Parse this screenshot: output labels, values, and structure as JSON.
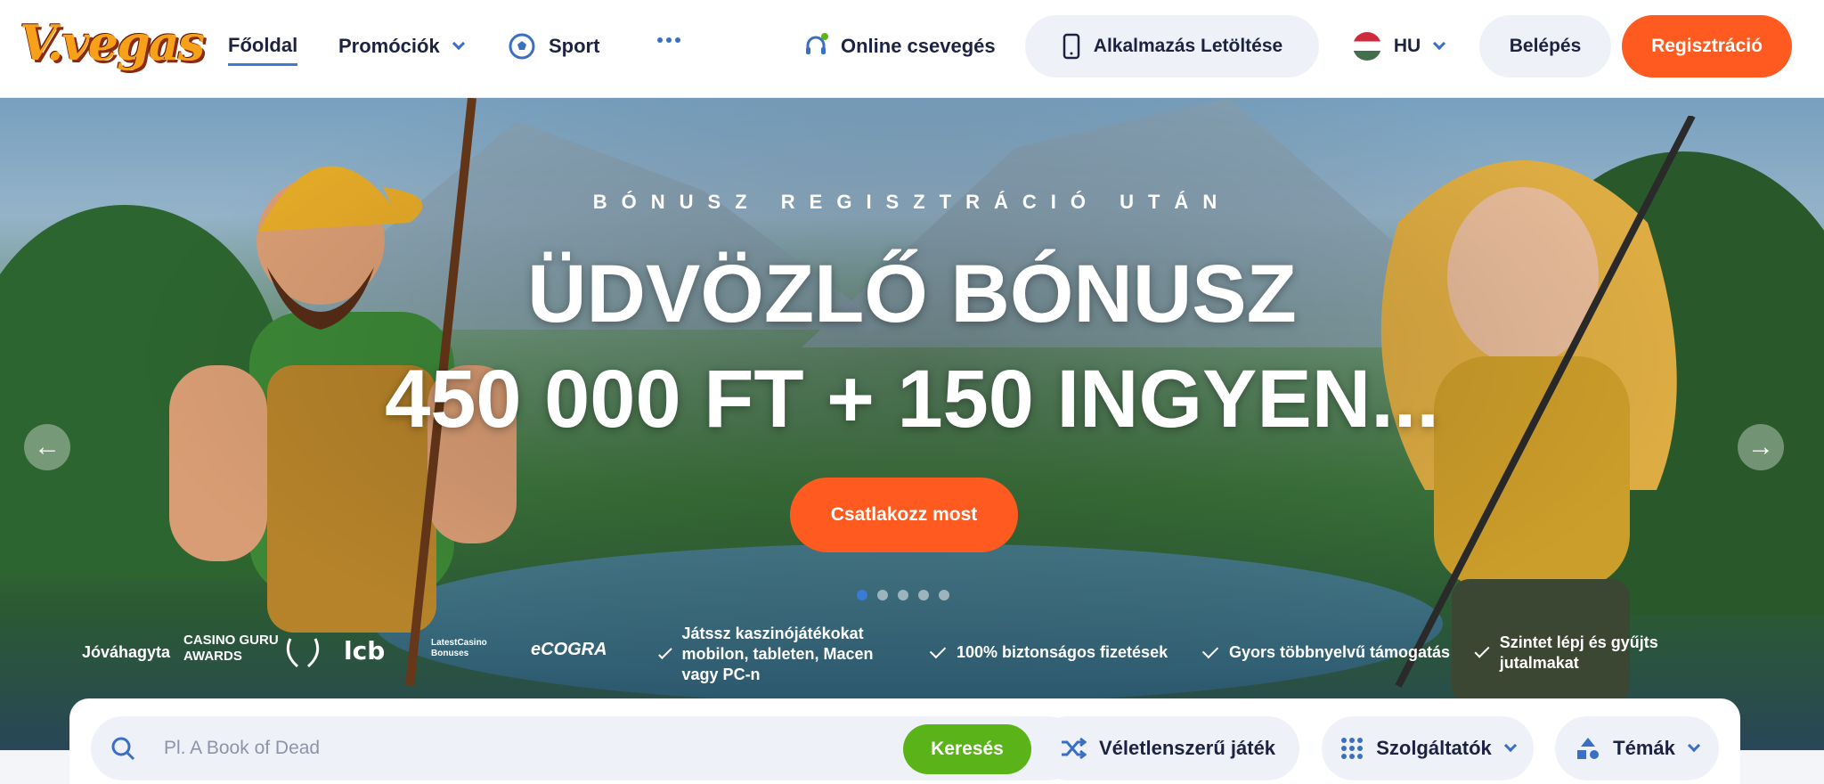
{
  "brand": {
    "logo_text": "V.vegas"
  },
  "nav": {
    "home": "Főoldal",
    "promotions": "Promóciók",
    "sport": "Sport",
    "more": "…",
    "chat": "Online csevegés",
    "app_download": "Alkalmazás Letöltése",
    "language": "HU",
    "login": "Belépés",
    "register": "Regisztráció"
  },
  "hero": {
    "subtitle": "BÓNUSZ REGISZTRÁCIÓ UTÁN",
    "title_line1": "ÜDVÖZLŐ BÓNUSZ",
    "title_line2": "450 000 FT + 150 INGYEN...",
    "cta": "Csatlakozz most",
    "slides_total": 5,
    "active_slide": 1
  },
  "trust": {
    "approved_label": "Jóváhagyta",
    "badges": [
      "CASINO GURU AWARDS",
      "lcb",
      "LatestCasino Bonuses",
      "eCOGRA"
    ],
    "features": [
      "Játssz kaszinójátékokat mobilon, tableten, Macen vagy PC-n",
      "100% biztonságos fizetések",
      "Gyors többnyelvű támogatás",
      "Szintet lépj és gyűjts jutalmakat"
    ]
  },
  "search": {
    "placeholder": "Pl. A Book of Dead",
    "button": "Keresés",
    "random_game": "Véletlenszerű játék",
    "providers": "Szolgáltatók",
    "themes": "Témák"
  },
  "colors": {
    "accent_orange": "#ff5a1f",
    "accent_blue": "#3a7bd5",
    "search_green": "#5bb31a",
    "text_dark": "#1c2340"
  }
}
